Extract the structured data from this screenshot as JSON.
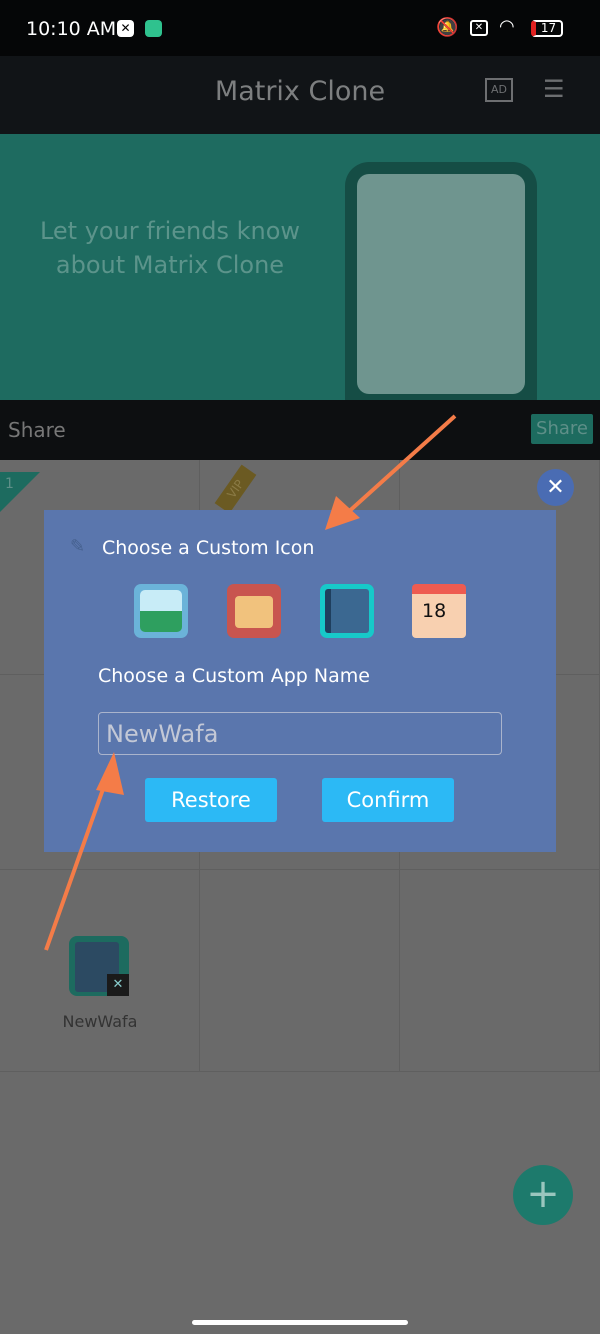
{
  "status_bar": {
    "time": "10:10 AM",
    "battery": "17"
  },
  "app_bar": {
    "title": "Matrix Clone",
    "ad_icon": "AD"
  },
  "banner": {
    "text": "Let your friends know about Matrix Clone"
  },
  "share_bar": {
    "label": "Share",
    "button": "Share"
  },
  "grid": {
    "badge_number": "1",
    "vip_label": "VIP",
    "app": {
      "name": "NewWafa"
    }
  },
  "dialog": {
    "icon_heading": "Choose a Custom Icon",
    "icons": [
      "gallery-icon",
      "wallet-icon",
      "notebook-icon",
      "calendar-icon"
    ],
    "calendar_day": "18",
    "name_heading": "Choose a Custom App Name",
    "name_input": {
      "value": "NewWafa"
    },
    "restore_label": "Restore",
    "confirm_label": "Confirm"
  },
  "colors": {
    "dialog": "#5a76ad",
    "button": "#2cb9f5",
    "accent": "#1e8a79",
    "arrow": "#f47c48"
  }
}
